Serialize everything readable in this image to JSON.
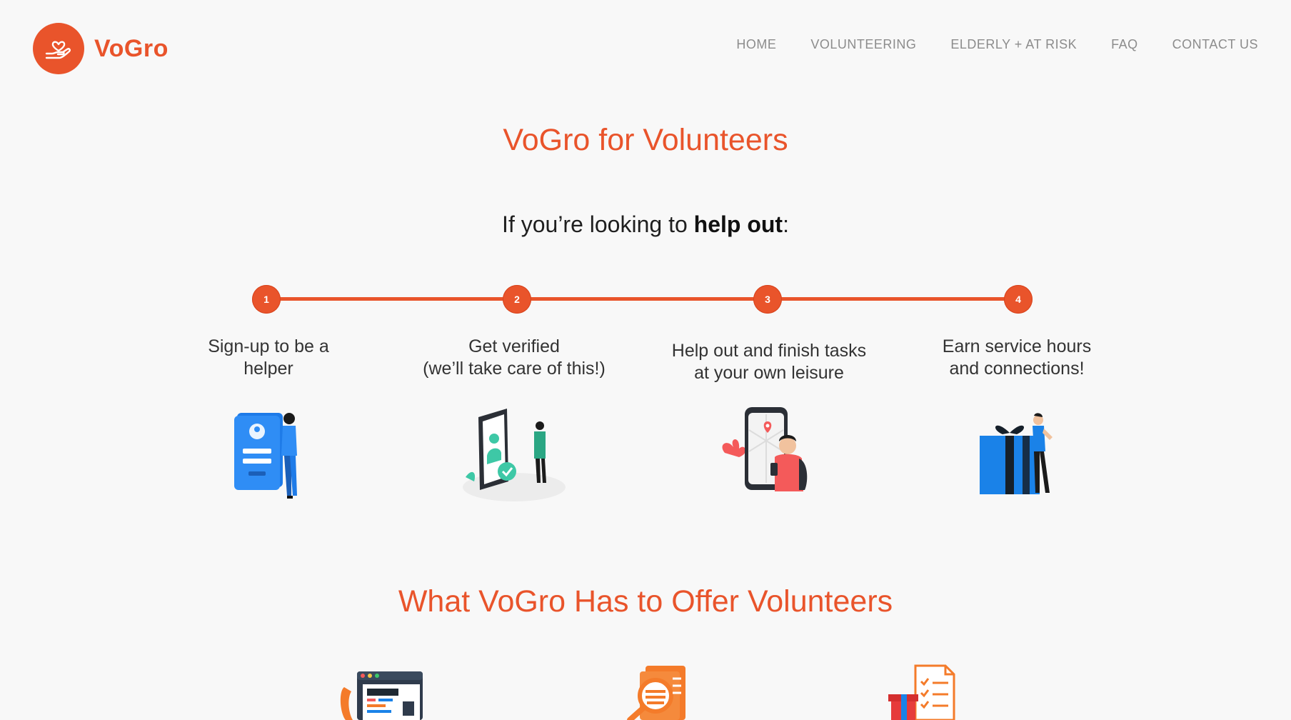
{
  "brand": {
    "name": "VoGro",
    "accent_color": "#e9542b",
    "logo_icon": "heart-in-hand-icon"
  },
  "nav": {
    "items": [
      {
        "label": "HOME"
      },
      {
        "label": "VOLUNTEERING"
      },
      {
        "label": "ELDERLY + AT RISK"
      },
      {
        "label": "FAQ"
      },
      {
        "label": "CONTACT US"
      }
    ]
  },
  "hero": {
    "title": "VoGro for Volunteers",
    "intro_prefix": "If you’re looking to ",
    "intro_bold": "help out",
    "intro_suffix": ":"
  },
  "steps": [
    {
      "number": "1",
      "line1": "Sign-up to be a",
      "line2": "helper",
      "illustration": "sign-up-illustration"
    },
    {
      "number": "2",
      "line1": "Get verified",
      "line2": "(we’ll take care of this!)",
      "illustration": "verified-illustration"
    },
    {
      "number": "3",
      "line1": "Help out and finish tasks",
      "line2": "at your own leisure",
      "illustration": "map-phone-illustration"
    },
    {
      "number": "4",
      "line1": "Earn service hours",
      "line2": "and connections!",
      "illustration": "gift-illustration"
    }
  ],
  "offers": {
    "title": "What VoGro Has to Offer Volunteers",
    "icons": [
      "phone-dashboard-icon",
      "magnifier-document-icon",
      "checklist-gift-icon"
    ]
  }
}
